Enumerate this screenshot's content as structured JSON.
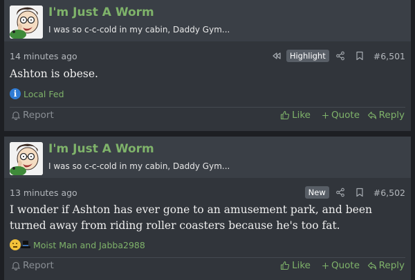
{
  "posts": [
    {
      "username": "I'm Just A Worm",
      "user_title": "I was so c-c-cold in my cabin, Daddy Gym...",
      "time": "14 minutes ago",
      "badge": "Highlight",
      "post_number": "#6,501",
      "body": "Ashton is obese.",
      "reactions_text": "Local Fed",
      "reaction_icon": "info-icon",
      "actions": {
        "report": "Report",
        "like": "Like",
        "quote": "Quote",
        "reply": "Reply"
      }
    },
    {
      "username": "I'm Just A Worm",
      "user_title": "I was so c-c-cold in my cabin, Daddy Gym...",
      "time": "13 minutes ago",
      "badge": "New",
      "post_number": "#6,502",
      "body": "I wonder if Ashton has ever gone to an amusement park, and been turned away from riding roller coasters because he's too fat.",
      "reactions_text": "Moist Man and Jabba2988",
      "reaction_icon": "thinking-emoji-and-top-hat-icons",
      "actions": {
        "report": "Report",
        "like": "Like",
        "quote": "Quote",
        "reply": "Reply"
      }
    }
  ],
  "colors": {
    "accent_green": "#7fb36a",
    "post_bg": "#31353b",
    "header_bg": "#3a3f46",
    "info_blue": "#2f7bd4"
  }
}
